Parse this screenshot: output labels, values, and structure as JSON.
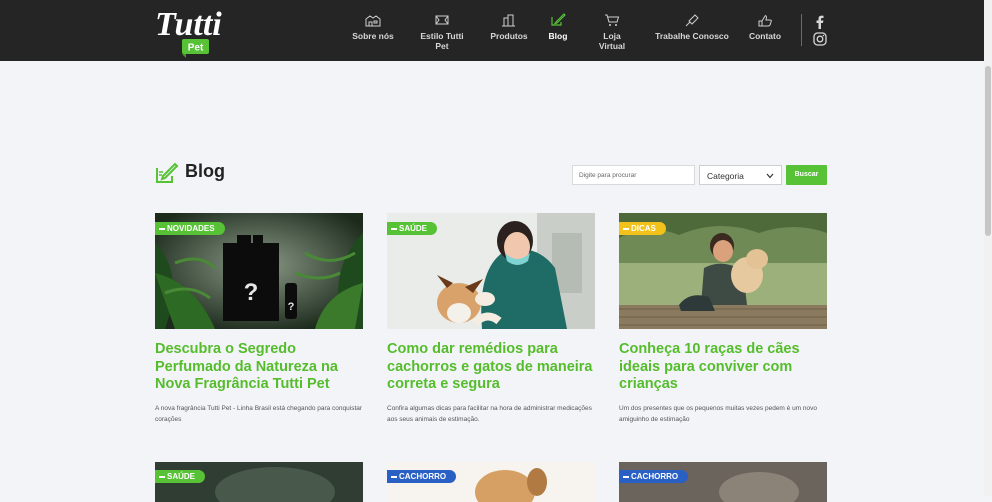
{
  "header": {
    "logo": {
      "top": "Tutti",
      "bottom": "Pet"
    },
    "nav": [
      {
        "label": "Sobre nós",
        "icon": "building-icon"
      },
      {
        "label": "Estilo Tutti Pet",
        "icon": "bone-icon"
      },
      {
        "label": "Produtos",
        "icon": "products-icon"
      },
      {
        "label": "Blog",
        "icon": "pencil-note-icon",
        "active": true
      },
      {
        "label": "Loja Virtual",
        "icon": "cart-icon"
      },
      {
        "label": "Trabalhe Conosco",
        "icon": "brush-icon"
      },
      {
        "label": "Contato",
        "icon": "hand-icon"
      }
    ],
    "social": [
      "facebook-icon",
      "instagram-icon"
    ]
  },
  "blog": {
    "title": "Blog",
    "search_placeholder": "Digite para procurar",
    "category_label": "Categoria",
    "search_button": "Buscar"
  },
  "colors": {
    "accent_green": "#57c236",
    "title_green": "#55bd2c",
    "badge_yellow": "#f2c21b",
    "badge_blue": "#2a5fc4",
    "header_bg": "#252525"
  },
  "posts": [
    {
      "category": "NOVIDADES",
      "title": "Descubra o Segredo Perfumado da Natureza na Nova Fragrância Tutti Pet",
      "excerpt": "A nova fragrância Tutti Pet - Linha Brasil está chegando para conquistar corações"
    },
    {
      "category": "SAÚDE",
      "title": "Como dar remédios para cachorros e gatos de maneira correta e segura",
      "excerpt": "Confira algumas dicas para facilitar na hora de administrar medicações aos seus animais de estimação."
    },
    {
      "category": "DICAS",
      "title": "Conheça 10 raças de cães ideais para conviver com crianças",
      "excerpt": "Um dos presentes que os pequenos muitas vezes pedem é um novo amiguinho de estimação"
    }
  ],
  "posts_row2": [
    {
      "category": "SAÚDE"
    },
    {
      "category": "CACHORRO"
    },
    {
      "category": "CACHORRO"
    }
  ]
}
